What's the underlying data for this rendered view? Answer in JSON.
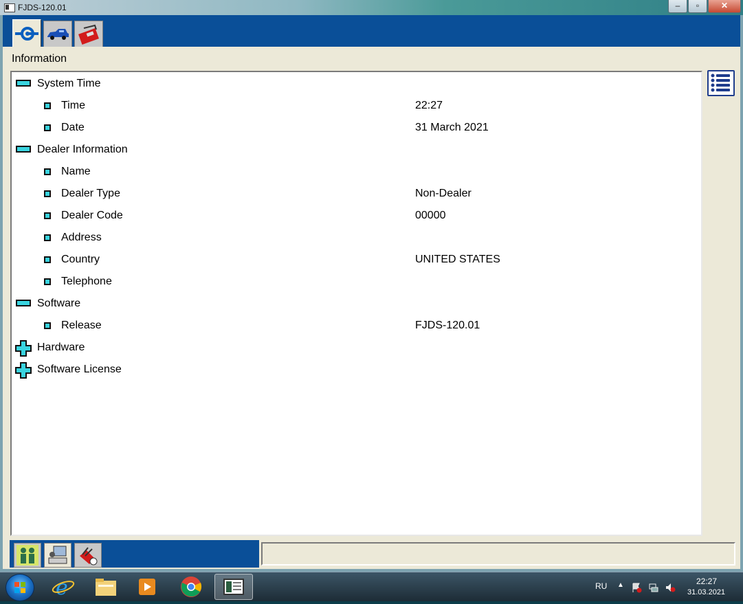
{
  "window": {
    "title": "FJDS-120.01",
    "controls": {
      "minimize": "–",
      "maximize": "▫",
      "close": "✕"
    }
  },
  "top_tabs": [
    {
      "icon": "connector-icon",
      "active": true
    },
    {
      "icon": "vehicle-icon",
      "active": false
    },
    {
      "icon": "toolbox-icon",
      "active": false
    }
  ],
  "section": {
    "title": "Information"
  },
  "tree": [
    {
      "label": "System Time",
      "level": 0,
      "expanded": true
    },
    {
      "label": "Time",
      "level": 1,
      "value": "22:27"
    },
    {
      "label": "Date",
      "level": 1,
      "value": "31 March 2021"
    },
    {
      "label": "Dealer Information",
      "level": 0,
      "expanded": true
    },
    {
      "label": "Name",
      "level": 1,
      "value": ""
    },
    {
      "label": "Dealer Type",
      "level": 1,
      "value": "Non-Dealer"
    },
    {
      "label": "Dealer Code",
      "level": 1,
      "value": "00000"
    },
    {
      "label": "Address",
      "level": 1,
      "value": ""
    },
    {
      "label": "Country",
      "level": 1,
      "value": "UNITED STATES"
    },
    {
      "label": "Telephone",
      "level": 1,
      "value": ""
    },
    {
      "label": "Software",
      "level": 0,
      "expanded": true
    },
    {
      "label": "Release",
      "level": 1,
      "value": "FJDS-120.01"
    },
    {
      "label": "Hardware",
      "level": 0,
      "expanded": false
    },
    {
      "label": "Software License",
      "level": 0,
      "expanded": false
    }
  ],
  "bottom_tabs": [
    {
      "icon": "people-icon",
      "active": false
    },
    {
      "icon": "computer-user-icon",
      "active": true
    },
    {
      "icon": "tools-checkmark-icon",
      "active": false
    }
  ],
  "taskbar": {
    "items": [
      "internet-explorer-icon",
      "file-explorer-icon",
      "media-player-icon",
      "chrome-icon",
      "fjds-app-icon"
    ],
    "language": "RU",
    "time": "22:27",
    "date": "31.03.2021"
  },
  "colors": {
    "tab_strip": "#0a4f98",
    "tree_icon_fill": "#39d4e0",
    "frame_bg": "#ece9d8"
  }
}
